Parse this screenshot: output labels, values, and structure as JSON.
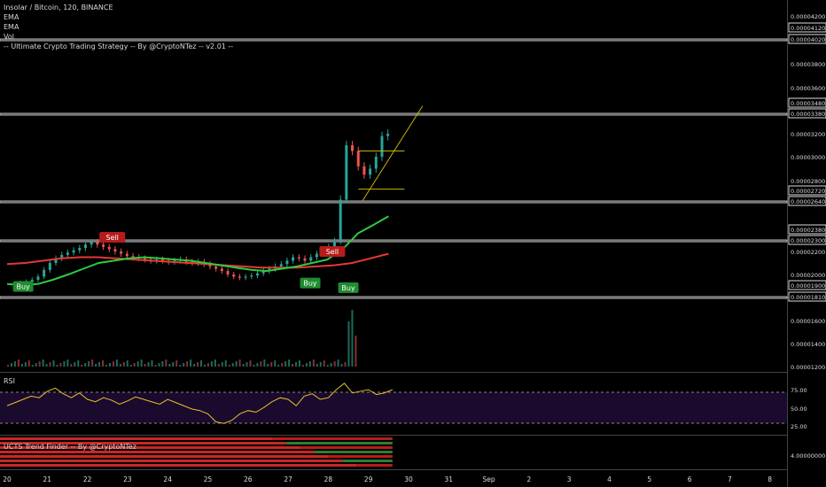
{
  "legend": {
    "symbol_line": "Insolar / Bitcoin, 120, BINANCE",
    "ema1": "EMA",
    "ema2": "EMA",
    "vol": "Vol",
    "strategy": "-- Ultimate Crypto Trading Strategy -- By @CryptoNTez -- v2.01 --"
  },
  "rsi_label": "RSI",
  "trend_label": "UCTS Trend Finder -- By @CryptoNTez",
  "colors": {
    "up": "#26a69a",
    "down": "#ef5350",
    "ema_fast": "#2ecc40",
    "ema_slow": "#e53935",
    "zone": "#9e9e9e",
    "trend": "#c8b400",
    "rsi": "#e6c229",
    "rsi_bg": "#1a0a2e"
  },
  "chart_data": [
    {
      "type": "candlestick",
      "title": "Insolar / Bitcoin, 120, BINANCE",
      "x_ticks": [
        "20",
        "21",
        "22",
        "23",
        "24",
        "25",
        "26",
        "27",
        "28",
        "29",
        "30",
        "31",
        "Sep",
        "2",
        "3",
        "4",
        "5",
        "6",
        "7",
        "8"
      ],
      "y_ticks": [
        "0.00004200",
        "0.00004120",
        "0.00004020",
        "0.00003800",
        "0.00003600",
        "0.00003480",
        "0.00003380",
        "0.00003200",
        "0.00003000",
        "0.00002800",
        "0.00002720",
        "0.00002640",
        "0.00002380",
        "0.00002300",
        "0.00002200",
        "0.00002000",
        "0.00001900",
        "0.00001810",
        "0.00001600",
        "0.00001400",
        "0.00001200"
      ],
      "ylim": [
        1.15e-05,
        4.3e-05
      ],
      "zones": [
        [
          4.02e-05,
          4.12e-05
        ],
        [
          3.38e-05,
          3.48e-05
        ],
        [
          2.64e-05,
          2.72e-05
        ],
        [
          2.3e-05,
          2.38e-05
        ],
        [
          1.81e-05,
          1.9e-05
        ]
      ],
      "signals": [
        {
          "label": "Buy",
          "day": 20.4,
          "price": 1.89e-05,
          "kind": "buy"
        },
        {
          "label": "Sell",
          "day": 22.62,
          "price": 2.32e-05,
          "kind": "sell"
        },
        {
          "label": "Buy",
          "day": 27.55,
          "price": 1.92e-05,
          "kind": "buy"
        },
        {
          "label": "Sell",
          "day": 28.1,
          "price": 2.2e-05,
          "kind": "sell"
        },
        {
          "label": "Buy",
          "day": 28.5,
          "price": 1.88e-05,
          "kind": "buy"
        }
      ],
      "series_close": [
        1.9e-05,
        1.91e-05,
        1.92e-05,
        1.93e-05,
        1.95e-05,
        1.98e-05,
        2.04e-05,
        2.1e-05,
        2.14e-05,
        2.17e-05,
        2.19e-05,
        2.21e-05,
        2.23e-05,
        2.26e-05,
        2.28e-05,
        2.26e-05,
        2.24e-05,
        2.22e-05,
        2.2e-05,
        2.18e-05,
        2.16e-05,
        2.15e-05,
        2.14e-05,
        2.13e-05,
        2.12e-05,
        2.13e-05,
        2.12e-05,
        2.11e-05,
        2.12e-05,
        2.13e-05,
        2.11e-05,
        2.1e-05,
        2.11e-05,
        2.09e-05,
        2.07e-05,
        2.05e-05,
        2.03e-05,
        2e-05,
        1.98e-05,
        1.97e-05,
        1.98e-05,
        1.99e-05,
        2.01e-05,
        2.03e-05,
        2.05e-05,
        2.07e-05,
        2.09e-05,
        2.12e-05,
        2.15e-05,
        2.14e-05,
        2.12e-05,
        2.15e-05,
        2.18e-05,
        2.21e-05,
        2.24e-05,
        2.29e-05,
        2.65e-05,
        3.1e-05,
        3.05e-05,
        2.92e-05,
        2.85e-05,
        2.9e-05,
        3e-05,
        3.18e-05,
        3.2e-05
      ],
      "ema_fast": [
        1.91e-05,
        1.9e-05,
        1.91e-05,
        1.95e-05,
        2e-05,
        2.05e-05,
        2.1e-05,
        2.12e-05,
        2.14e-05,
        2.15e-05,
        2.14e-05,
        2.13e-05,
        2.12e-05,
        2.1e-05,
        2.08e-05,
        2.06e-05,
        2.04e-05,
        2.03e-05,
        2.05e-05,
        2.07e-05,
        2.1e-05,
        2.13e-05,
        2.22e-05,
        2.35e-05,
        2.42e-05,
        2.5e-05
      ],
      "ema_slow": [
        2.09e-05,
        2.1e-05,
        2.12e-05,
        2.14e-05,
        2.15e-05,
        2.15e-05,
        2.14e-05,
        2.13e-05,
        2.12e-05,
        2.11e-05,
        2.1e-05,
        2.09e-05,
        2.08e-05,
        2.07e-05,
        2.06e-05,
        2.06e-05,
        2.06e-05,
        2.07e-05,
        2.08e-05,
        2.1e-05,
        2.14e-05,
        2.18e-05
      ]
    },
    {
      "type": "line",
      "title": "RSI",
      "y_ticks": [
        "75.00",
        "50.00",
        "25.00"
      ],
      "ylim": [
        15,
        90
      ],
      "bands": [
        70,
        30
      ]
    },
    {
      "type": "heatmap",
      "title": "UCTS Trend Finder -- By @CryptoNTez",
      "y_ticks": [
        "4.00000000"
      ]
    }
  ]
}
